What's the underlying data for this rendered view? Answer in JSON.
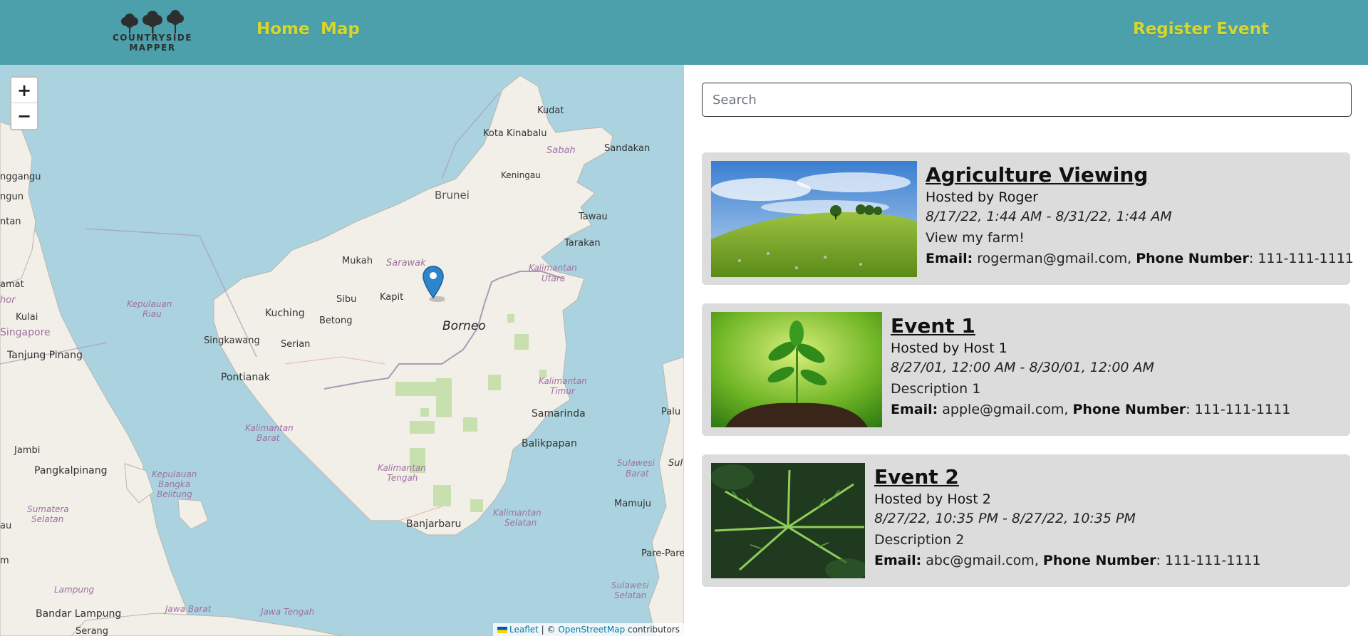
{
  "brand": {
    "logo_line1": "COUNTRYSIDE",
    "logo_line2": "MAPPER"
  },
  "nav": {
    "home": "Home",
    "map": "Map",
    "register": "Register Event"
  },
  "map": {
    "zoom_in": "+",
    "zoom_out": "−",
    "labels": {
      "kudat": "Kudat",
      "kota_kinabalu": "Kota Kinabalu",
      "sabah": "Sabah",
      "sandakan": "Sandakan",
      "keningau": "Keningau",
      "brunei": "Brunei",
      "tawau": "Tawau",
      "tarakan": "Tarakan",
      "mukah": "Mukah",
      "sarawak": "Sarawak",
      "kaltara1": "Kalimantan",
      "kaltara2": "Utara",
      "sibu": "Sibu",
      "kapit": "Kapit",
      "kuching": "Kuching",
      "betong": "Betong",
      "borneo": "Borneo",
      "singkawang": "Singkawang",
      "serian": "Serian",
      "pontianak": "Pontianak",
      "kaltim1": "Kalimantan",
      "kaltim2": "Timur",
      "samarinda": "Samarinda",
      "balikpapan": "Balikpapan",
      "kalbar1": "Kalimantan",
      "kalbar2": "Barat",
      "kalteng1": "Kalimantan",
      "kalteng2": "Tengah",
      "kalsel1": "Kalimantan",
      "kalsel2": "Selatan",
      "banjarbaru": "Banjarbaru",
      "sulbar1": "Sulawesi",
      "sulbar2": "Barat",
      "mamuju": "Mamuju",
      "parepare": "Pare-Pare",
      "palu": "Palu",
      "sul": "Sul",
      "sulsel1": "Sulawesi",
      "sulsel2": "Selatan",
      "nggangu": "nggangu",
      "ngun": "ngun",
      "ntan": "ntan",
      "amat": "amat",
      "hor": "hor",
      "kulai": "Kulai",
      "singapore": "Singapore",
      "tanjung_pinang": "Tanjung Pinang",
      "kepriau1": "Kepulauan",
      "kepriau2": "Riau",
      "jambi": "Jambi",
      "pangkalpinang": "Pangkalpinang",
      "kepbel1": "Kepulauan",
      "kepbel2": "Bangka",
      "kepbel3": "Belitung",
      "sumsel1": "Sumatera",
      "sumsel2": "Selatan",
      "au": "au",
      "m": "m",
      "lampung": "Lampung",
      "jawa_barat": "Jawa Barat",
      "jawa_tengah": "Jawa Tengah",
      "bandar_lampung": "Bandar Lampung",
      "serang": "Serang"
    },
    "attribution": {
      "leaflet": "Leaflet",
      "sep": " | © ",
      "osm": "OpenStreetMap",
      "contrib": " contributors"
    }
  },
  "search": {
    "placeholder": "Search",
    "value": ""
  },
  "labels": {
    "email": "Email:",
    "phone": "Phone Number"
  },
  "events": [
    {
      "title": "Agriculture Viewing",
      "host": "Hosted by Roger",
      "dates": "8/17/22, 1:44 AM - 8/31/22, 1:44 AM",
      "description": "View my farm!",
      "email": "rogerman@gmail.com",
      "phone": "111-111-1111"
    },
    {
      "title": "Event 1",
      "host": "Hosted by Host 1",
      "dates": "8/27/01, 12:00 AM - 8/30/01, 12:00 AM",
      "description": "Description 1",
      "email": "apple@gmail.com",
      "phone": "111-111-1111"
    },
    {
      "title": "Event 2",
      "host": "Hosted by Host 2",
      "dates": "8/27/22, 10:35 PM - 8/27/22, 10:35 PM",
      "description": "Description 2",
      "email": "abc@gmail.com",
      "phone": "111-111-1111"
    }
  ],
  "colors": {
    "navbar": "#4ba0ab",
    "nav_link": "#d6d62e",
    "card_bg": "#dcdcdc",
    "sea": "#aad3df",
    "land": "#f2efe9"
  }
}
